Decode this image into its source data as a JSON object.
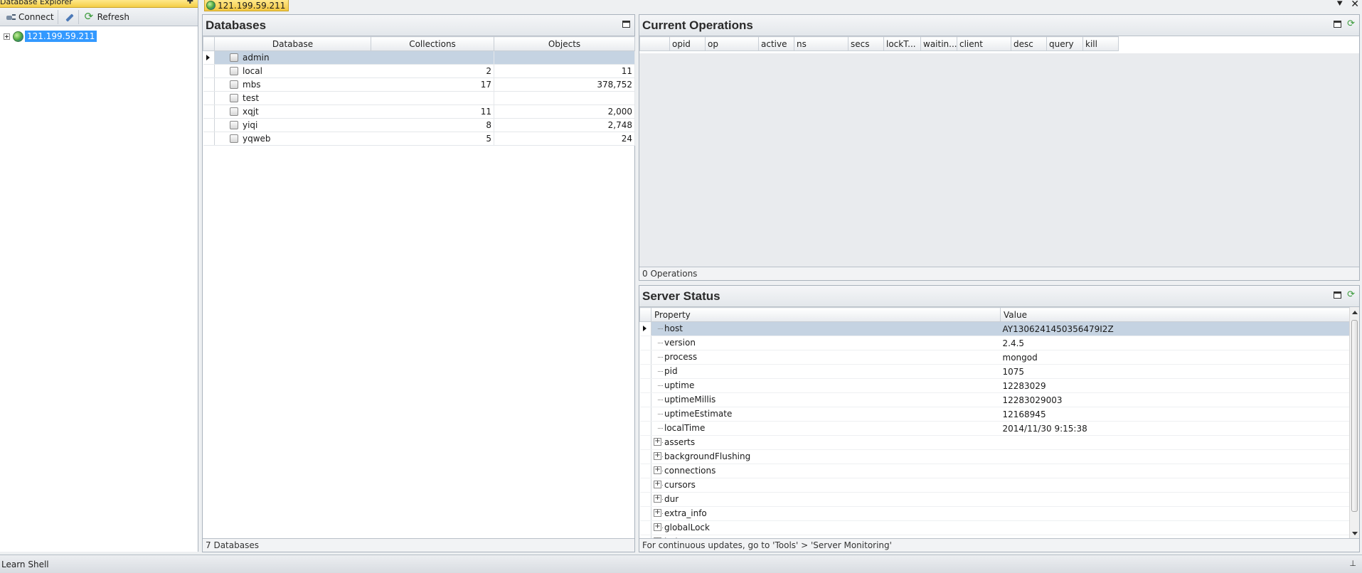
{
  "explorer": {
    "title": "Database Explorer",
    "pin_glyph": "✚",
    "toolbar": {
      "connect_label": "Connect",
      "refresh_label": "Refresh"
    },
    "tree": {
      "server_label": "121.199.59.211"
    }
  },
  "doc_tab": {
    "label": "121.199.59.211"
  },
  "window_controls": {
    "menu_glyph": "⯆",
    "close_glyph": "✕"
  },
  "databases": {
    "title": "Databases",
    "columns": [
      "Database",
      "Collections",
      "Objects"
    ],
    "rows": [
      {
        "name": "admin",
        "collections": "",
        "objects": ""
      },
      {
        "name": "local",
        "collections": "2",
        "objects": "11"
      },
      {
        "name": "mbs",
        "collections": "17",
        "objects": "378,752"
      },
      {
        "name": "test",
        "collections": "",
        "objects": ""
      },
      {
        "name": "xqjt",
        "collections": "11",
        "objects": "2,000"
      },
      {
        "name": "yiqi",
        "collections": "8",
        "objects": "2,748"
      },
      {
        "name": "yqweb",
        "collections": "5",
        "objects": "24"
      }
    ],
    "footer": "7 Databases"
  },
  "operations": {
    "title": "Current Operations",
    "columns": [
      "opid",
      "op",
      "active",
      "ns",
      "secs",
      "lockT...",
      "waitin...",
      "client",
      "desc",
      "query",
      "kill"
    ],
    "footer": "0 Operations"
  },
  "server_status": {
    "title": "Server Status",
    "columns": [
      "Property",
      "Value"
    ],
    "rows": [
      {
        "property": "host",
        "value": "AY1306241450356479I2Z"
      },
      {
        "property": "version",
        "value": "2.4.5"
      },
      {
        "property": "process",
        "value": "mongod"
      },
      {
        "property": "pid",
        "value": "1075"
      },
      {
        "property": "uptime",
        "value": "12283029"
      },
      {
        "property": "uptimeMillis",
        "value": "12283029003"
      },
      {
        "property": "uptimeEstimate",
        "value": "12168945"
      },
      {
        "property": "localTime",
        "value": "2014/11/30 9:15:38"
      },
      {
        "property": "asserts",
        "value": ""
      },
      {
        "property": "backgroundFlushing",
        "value": ""
      },
      {
        "property": "connections",
        "value": ""
      },
      {
        "property": "cursors",
        "value": ""
      },
      {
        "property": "dur",
        "value": ""
      },
      {
        "property": "extra_info",
        "value": ""
      },
      {
        "property": "globalLock",
        "value": ""
      },
      {
        "property": "indexCounters",
        "value": ""
      }
    ],
    "footer": "For continuous updates, go to 'Tools' > 'Server Monitoring'"
  },
  "shell_bar": {
    "label": "Learn Shell",
    "pin_glyph": "⊥"
  }
}
